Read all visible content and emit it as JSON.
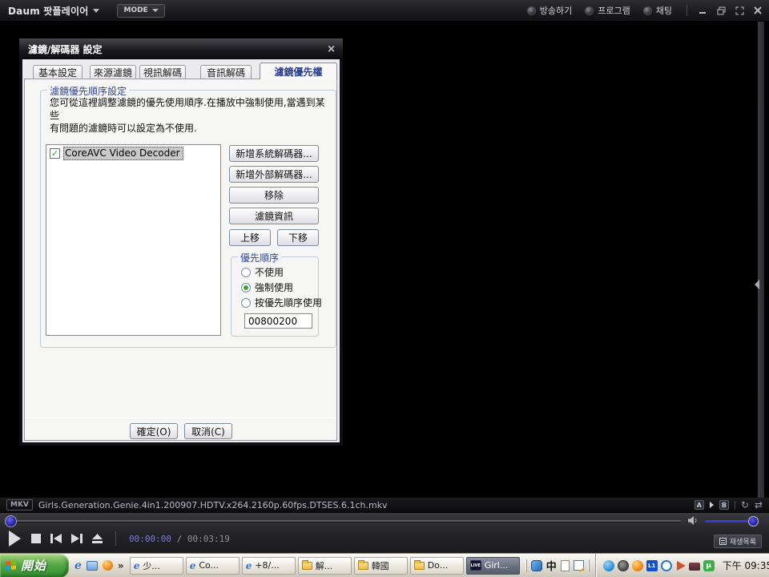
{
  "window": {
    "app_title": "Daum 팟플레이어",
    "mode_label": "MODE",
    "titlebar_buttons": [
      {
        "label": "방송하기"
      },
      {
        "label": "프로그램"
      },
      {
        "label": "채팅"
      }
    ]
  },
  "dialog": {
    "title": "濾鏡/解碼器 設定",
    "close_label": "×",
    "tabs": [
      {
        "label": "基本設定",
        "selected": false
      },
      {
        "label": "來源濾鏡",
        "selected": false
      },
      {
        "label": "視訊解碼",
        "selected": false
      },
      {
        "label": "音訊解碼",
        "selected": false
      },
      {
        "label": "濾鏡優先權",
        "selected": true
      }
    ],
    "group_title": "濾鏡優先順序設定",
    "description_line1": "您可從這裡調整濾鏡的優先使用順序.在播放中強制使用,當遇到某些",
    "description_line2": "有問題的濾鏡時可以設定為不使用.",
    "filter_list": [
      {
        "label": "CoreAVC Video Decoder",
        "checked": true,
        "selected": true,
        "check_glyph": "✓"
      }
    ],
    "buttons": {
      "add_system": "新增系統解碼器...",
      "add_external": "新增外部解碼器...",
      "remove": "移除",
      "filter_info": "濾鏡資訊",
      "move_up": "上移",
      "move_down": "下移"
    },
    "priority_group": {
      "title": "優先順序",
      "options": [
        {
          "label": "不使用",
          "selected": false
        },
        {
          "label": "強制使用",
          "selected": true
        },
        {
          "label": "按優先順序使用",
          "selected": false
        }
      ],
      "merit_value": "00800200"
    },
    "ok_label": "確定(O)",
    "cancel_label": "取消(C)"
  },
  "infobar": {
    "format_badge": "MKV",
    "filename": "Girls.Generation.Genie.4in1.200907.HDTV.x264.2160p.60fps.DTSES.6.1ch.mkv",
    "ab_a": "A",
    "ab_b": "B",
    "repeat_glyph": "↻",
    "shuffle_glyph": "⇄"
  },
  "controls": {
    "current_time": "00:00:00",
    "time_separator": "/",
    "total_time": "00:03:19",
    "playlist_label": "재생목록",
    "seek_percent": 0,
    "volume_percent": 100
  },
  "taskbar": {
    "start_label": "開始",
    "overflow_chevron": "»",
    "quick_launch_icons": [
      "internet-explorer",
      "show-desktop",
      "orange-ball"
    ],
    "task_buttons": [
      {
        "label": "少...",
        "icon": "internet-explorer",
        "active": false
      },
      {
        "label": "Co...",
        "icon": "internet-explorer",
        "active": false
      },
      {
        "label": "+8/...",
        "icon": "internet-explorer",
        "active": false
      },
      {
        "label": "解...",
        "icon": "folder",
        "active": false
      },
      {
        "label": "韓國",
        "icon": "folder",
        "active": false
      },
      {
        "label": "Do...",
        "icon": "folder",
        "active": false
      },
      {
        "label": "Girl...",
        "icon": "potplayer-live",
        "active": true
      }
    ],
    "potplayer_icon_text": "LIVE",
    "ime_indicator": "中",
    "l1_icon_text": "L1",
    "utorrent_icon_text": "µ",
    "tray_icons": [
      "messenger",
      "clock-app",
      "orange-ball",
      "l1-app",
      "emule",
      "volume",
      "scanner",
      "utorrent"
    ],
    "clock": "下午 09:35"
  },
  "colors": {
    "volume_accent": "#3a3ad0",
    "time_accent": "#7d7dd8",
    "group_title_blue": "#35488f",
    "selected_tab_text": "#2b3f8f",
    "start_button_green": "#2f8a2f",
    "radio_selected_green": "#3aa43a",
    "selection_gray": "#c9c9c9"
  }
}
